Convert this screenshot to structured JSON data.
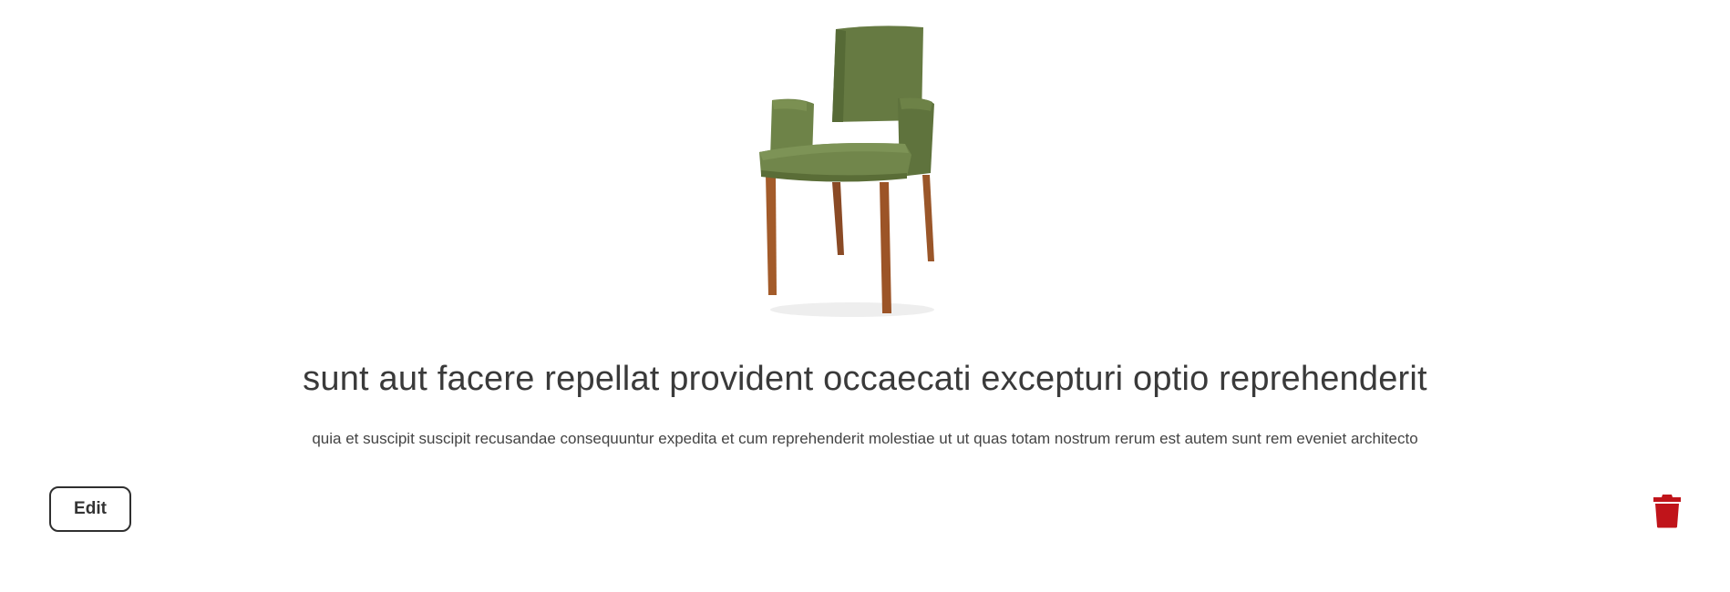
{
  "product": {
    "image_icon": "chair-image",
    "title": "sunt aut facere repellat provident occaecati excepturi optio reprehenderit",
    "description": "quia et suscipit suscipit recusandae consequuntur expedita et cum reprehenderit molestiae ut ut quas totam nostrum rerum est autem sunt rem eveniet architecto"
  },
  "actions": {
    "edit_label": "Edit",
    "delete_icon": "trash-icon",
    "delete_color": "#c0141a"
  }
}
